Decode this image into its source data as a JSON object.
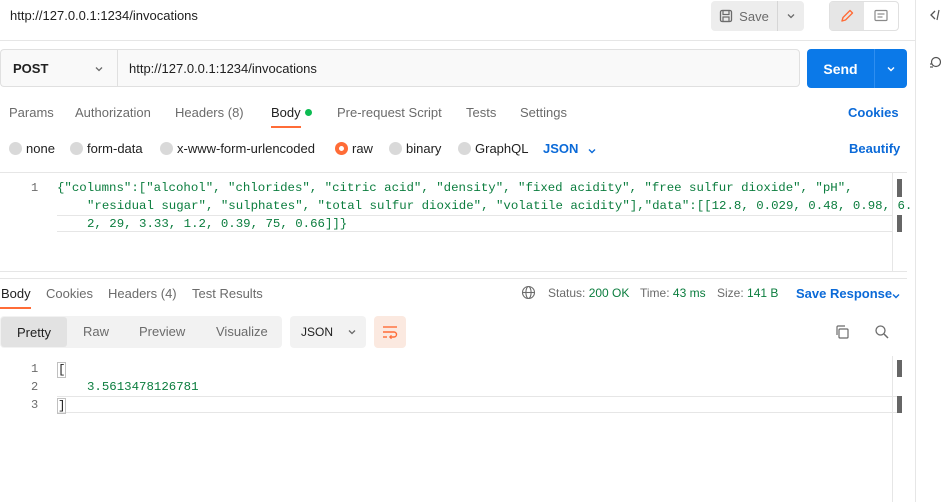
{
  "header": {
    "title": "http://127.0.0.1:1234/invocations",
    "save_label": "Save"
  },
  "request": {
    "method": "POST",
    "url": "http://127.0.0.1:1234/invocations",
    "send_label": "Send"
  },
  "request_tabs": {
    "params": "Params",
    "authorization": "Authorization",
    "headers": "Headers (8)",
    "body": "Body",
    "pre_request": "Pre-request Script",
    "tests": "Tests",
    "settings": "Settings",
    "cookies": "Cookies"
  },
  "body_modes": {
    "none": "none",
    "form_data": "form-data",
    "urlencoded": "x-www-form-urlencoded",
    "raw": "raw",
    "binary": "binary",
    "graphql": "GraphQL",
    "format": "JSON",
    "beautify": "Beautify"
  },
  "request_body": {
    "line_number": "1",
    "line1": "{\"columns\":[\"alcohol\", \"chlorides\", \"citric acid\", \"density\", \"fixed acidity\", \"free sulfur dioxide\", \"pH\",",
    "line2": "\"residual sugar\", \"sulphates\", \"total sulfur dioxide\", \"volatile acidity\"],\"data\":[[12.8, 0.029, 0.48, 0.98, 6.",
    "line3": "2, 29, 3.33, 1.2, 0.39, 75, 0.66]]}"
  },
  "response_tabs": {
    "body": "Body",
    "cookies": "Cookies",
    "headers": "Headers (4)",
    "test_results": "Test Results"
  },
  "response_meta": {
    "status_label": "Status:",
    "status_value": "200 OK",
    "time_label": "Time:",
    "time_value": "43 ms",
    "size_label": "Size:",
    "size_value": "141 B",
    "save_response": "Save Response"
  },
  "response_view": {
    "pretty": "Pretty",
    "raw": "Raw",
    "preview": "Preview",
    "visualize": "Visualize",
    "format": "JSON"
  },
  "response_body": {
    "ln1": "1",
    "ln2": "2",
    "ln3": "3",
    "line1": "[",
    "line2": "3.5613478126781",
    "line3": "]"
  },
  "colors": {
    "accent_orange": "#ff6c37",
    "send_blue": "#0b79e8",
    "link_blue": "#0b6ad8",
    "status_green": "#0b7d3e"
  }
}
